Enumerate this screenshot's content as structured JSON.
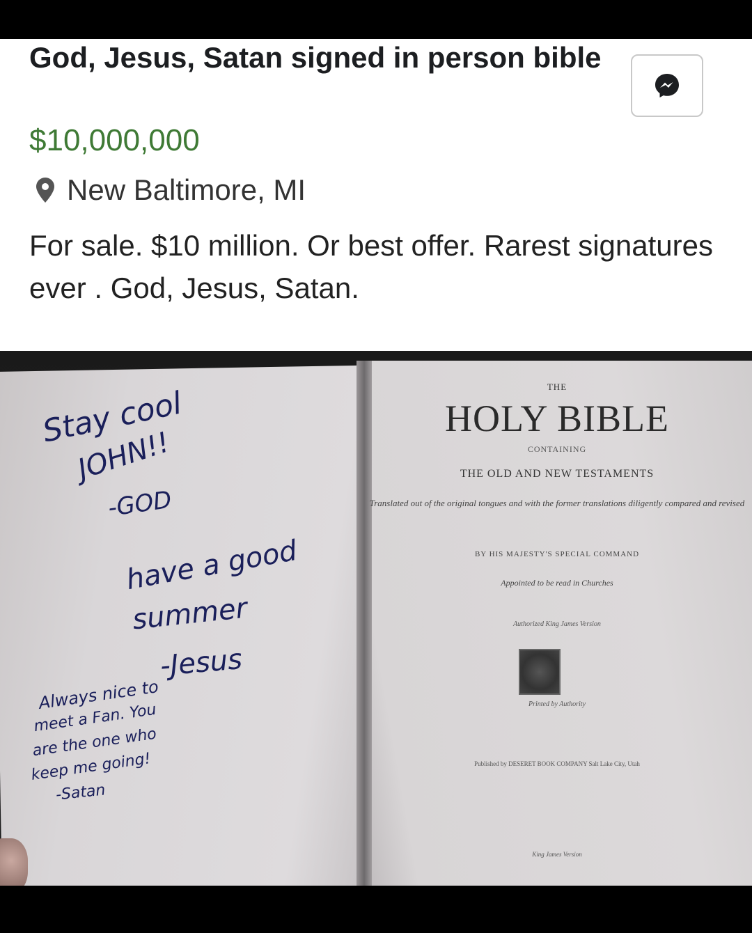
{
  "listing": {
    "title": "God, Jesus, Satan signed in person bible",
    "price": "$10,000,000",
    "location": "New Baltimore, MI",
    "description": "For sale. $10 million. Or best offer. Rarest signatures ever . God, Jesus, Satan.",
    "message_icon": "messenger-icon",
    "location_icon": "map-pin-icon"
  },
  "photo": {
    "handwriting": {
      "god_line1": "Stay cool",
      "god_line2": "JOHN!!",
      "god_sign": "-GOD",
      "jesus_line1": "have a good",
      "jesus_line2": "summer",
      "jesus_sign": "-Jesus",
      "satan_line1": "Always nice to",
      "satan_line2": "meet a Fan. You",
      "satan_line3": "are the one who",
      "satan_line4": "keep me going!",
      "satan_sign": "-Satan"
    },
    "bible_page": {
      "the": "THE",
      "title": "HOLY BIBLE",
      "containing": "CONTAINING",
      "testaments": "THE OLD AND NEW TESTAMENTS",
      "translated": "Translated out of the original tongues and with the former translations diligently compared and revised",
      "command": "BY HIS MAJESTY'S SPECIAL COMMAND",
      "appointed": "Appointed to be read in Churches",
      "authorized": "Authorized King James Version",
      "printed_by": "Printed by Authority",
      "publisher": "Published by DESERET BOOK COMPANY Salt Lake City, Utah",
      "bottom": "King James Version"
    }
  }
}
